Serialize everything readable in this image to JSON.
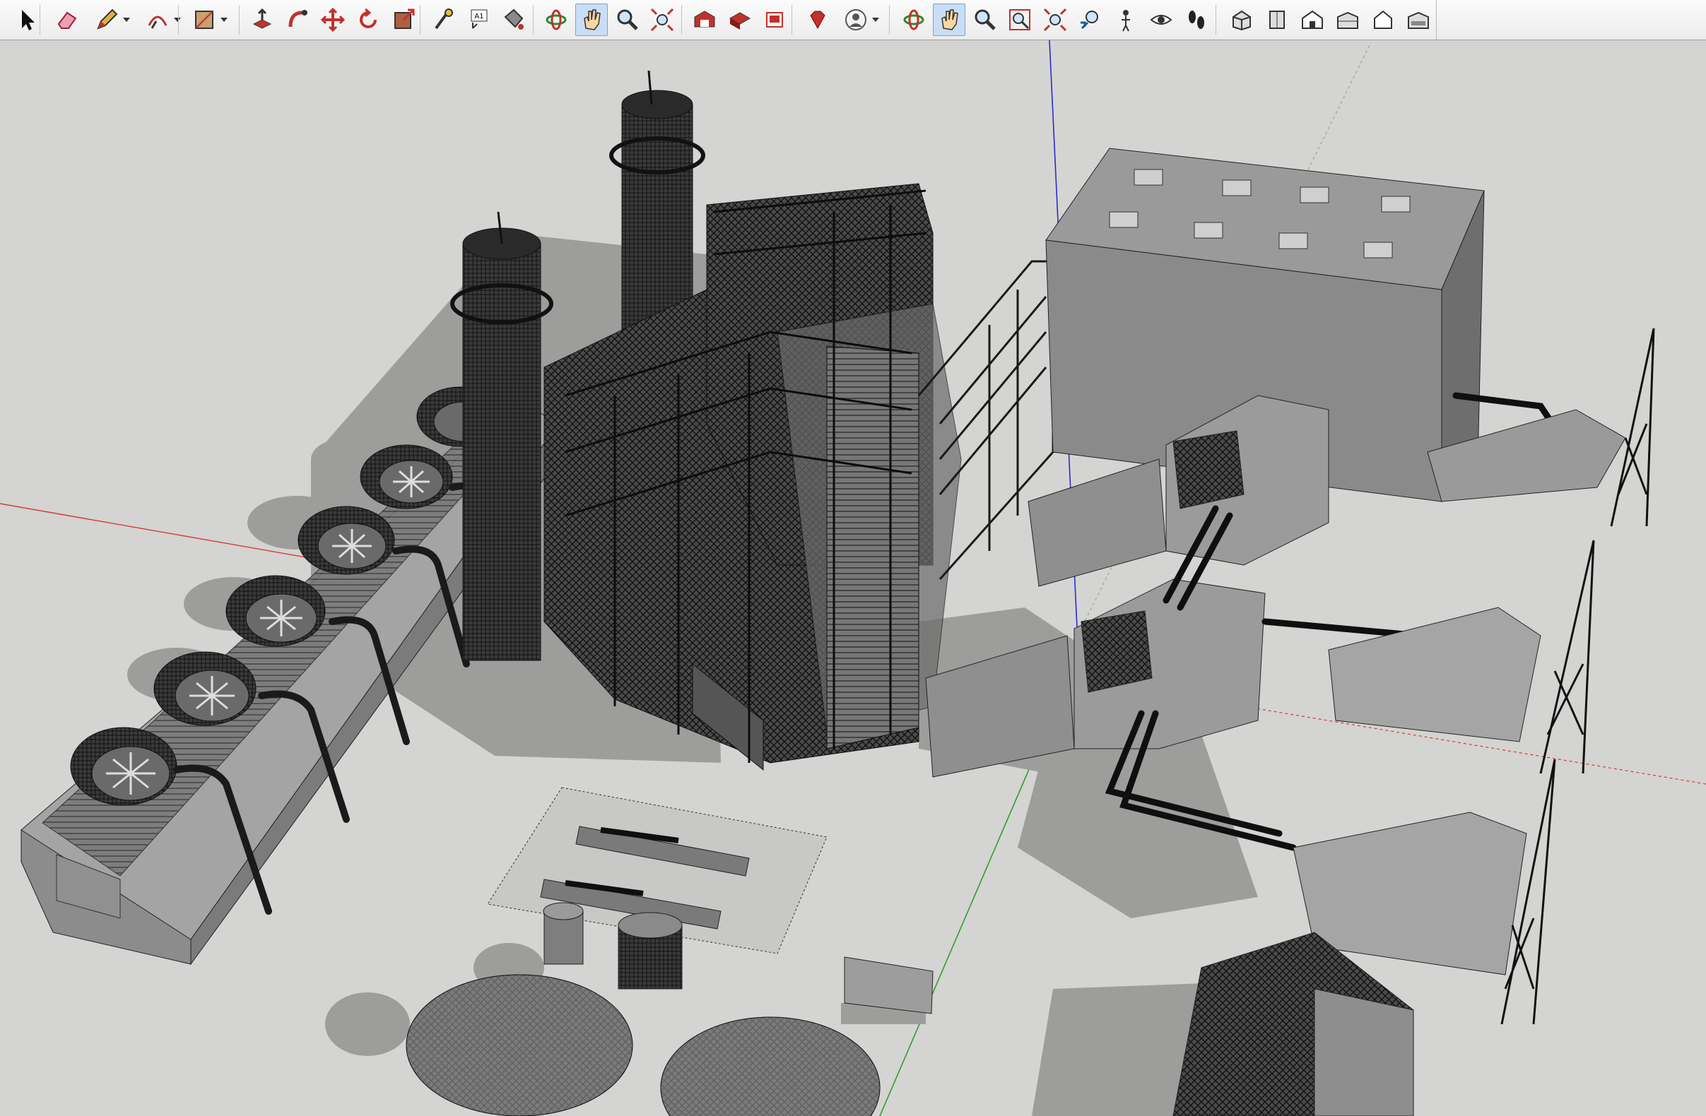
{
  "app": {
    "name": "SketchUp"
  },
  "toolbar": {
    "tools": [
      {
        "name": "select-tool",
        "icon": "arrow-cursor-icon"
      },
      {
        "name": "eraser-tool",
        "icon": "eraser-icon"
      },
      {
        "name": "line-tool",
        "icon": "pencil-icon",
        "dropdown": true
      },
      {
        "name": "arc-tool",
        "icon": "arc-icon",
        "dropdown": true
      },
      {
        "name": "rectangle-tool",
        "icon": "rectangle-icon",
        "dropdown": true
      },
      {
        "name": "push-pull-tool",
        "icon": "push-pull-icon"
      },
      {
        "name": "follow-me-tool",
        "icon": "follow-me-icon"
      },
      {
        "name": "move-tool",
        "icon": "move-icon"
      },
      {
        "name": "rotate-tool",
        "icon": "rotate-icon"
      },
      {
        "name": "scale-tool",
        "icon": "scale-icon"
      },
      {
        "name": "tape-measure-tool",
        "icon": "tape-measure-icon"
      },
      {
        "name": "text-tool",
        "icon": "text-icon",
        "glyph": "A1"
      },
      {
        "name": "paint-bucket-tool",
        "icon": "paint-bucket-icon"
      },
      {
        "name": "orbit-tool",
        "icon": "orbit-icon"
      },
      {
        "name": "pan-tool",
        "icon": "hand-icon",
        "active": true
      },
      {
        "name": "zoom-tool",
        "icon": "magnifier-icon"
      },
      {
        "name": "zoom-extents-tool",
        "icon": "zoom-extents-icon"
      },
      {
        "name": "warehouse-tool",
        "icon": "warehouse-icon"
      },
      {
        "name": "share-model-tool",
        "icon": "share-model-icon"
      },
      {
        "name": "extension-warehouse-tool",
        "icon": "extension-icon"
      },
      {
        "name": "ruby-tool",
        "icon": "ruby-gem-icon"
      },
      {
        "name": "account-menu",
        "icon": "account-icon",
        "dropdown": true
      },
      {
        "name": "orbit-tool-2",
        "icon": "orbit-icon"
      },
      {
        "name": "pan-tool-2",
        "icon": "hand-icon",
        "active": true
      },
      {
        "name": "zoom-tool-2",
        "icon": "magnifier-icon"
      },
      {
        "name": "zoom-window-tool",
        "icon": "zoom-window-icon"
      },
      {
        "name": "zoom-extents-tool-2",
        "icon": "zoom-extents-icon"
      },
      {
        "name": "previous-view-tool",
        "icon": "previous-view-icon"
      },
      {
        "name": "position-camera-tool",
        "icon": "position-camera-icon"
      },
      {
        "name": "look-around-tool",
        "icon": "eye-icon"
      },
      {
        "name": "walk-tool",
        "icon": "footprints-icon"
      },
      {
        "name": "iso-view",
        "icon": "iso-view-icon"
      },
      {
        "name": "top-view",
        "icon": "top-view-icon"
      },
      {
        "name": "front-view",
        "icon": "front-view-icon"
      },
      {
        "name": "right-view",
        "icon": "right-view-icon"
      },
      {
        "name": "back-view",
        "icon": "back-view-icon"
      },
      {
        "name": "left-view",
        "icon": "left-view-icon"
      }
    ]
  },
  "scene": {
    "description_visible": false,
    "axis_colors": {
      "red": "#d23a3a",
      "green": "#2da02d",
      "blue": "#2a2ad0"
    },
    "background": "#d4d4d2"
  }
}
